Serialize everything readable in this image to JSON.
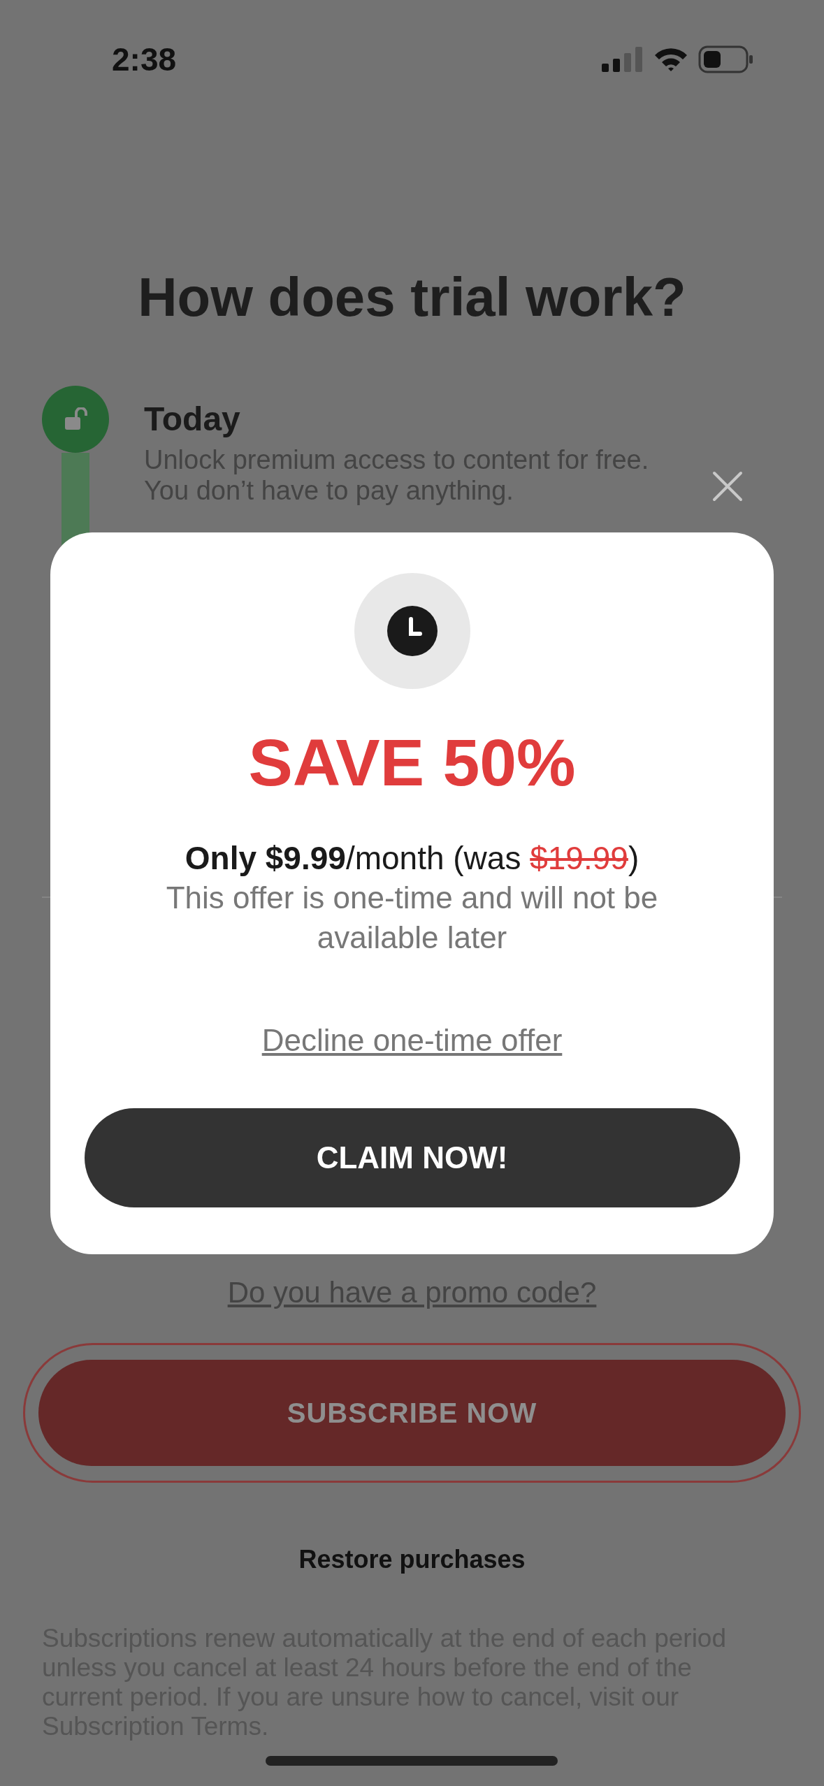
{
  "status_bar": {
    "time": "2:38"
  },
  "title": "How does trial work?",
  "steps": [
    {
      "kind": "unlock",
      "title": "Today",
      "description": "Unlock premium access to content for free. You don’t have to pay anything."
    }
  ],
  "promo_link": "Do you have a promo code?",
  "subscribe_button": "SUBSCRIBE NOW",
  "restore_link": "Restore purchases",
  "legal_text": "Subscriptions renew automatically at the end of each period unless you cancel at least 24 hours before the end of the current period. If you are unsure how to cancel, visit our Subscription Terms.",
  "modal": {
    "headline": "SAVE 50%",
    "price_line": {
      "lead": "Only $9.99",
      "unit": "/month (was ",
      "old_price": "$19.99",
      "tail": ")"
    },
    "description": "This offer is one-time and will not be available later",
    "decline_link": "Decline one-time offer",
    "claim_button": "CLAIM NOW!"
  }
}
